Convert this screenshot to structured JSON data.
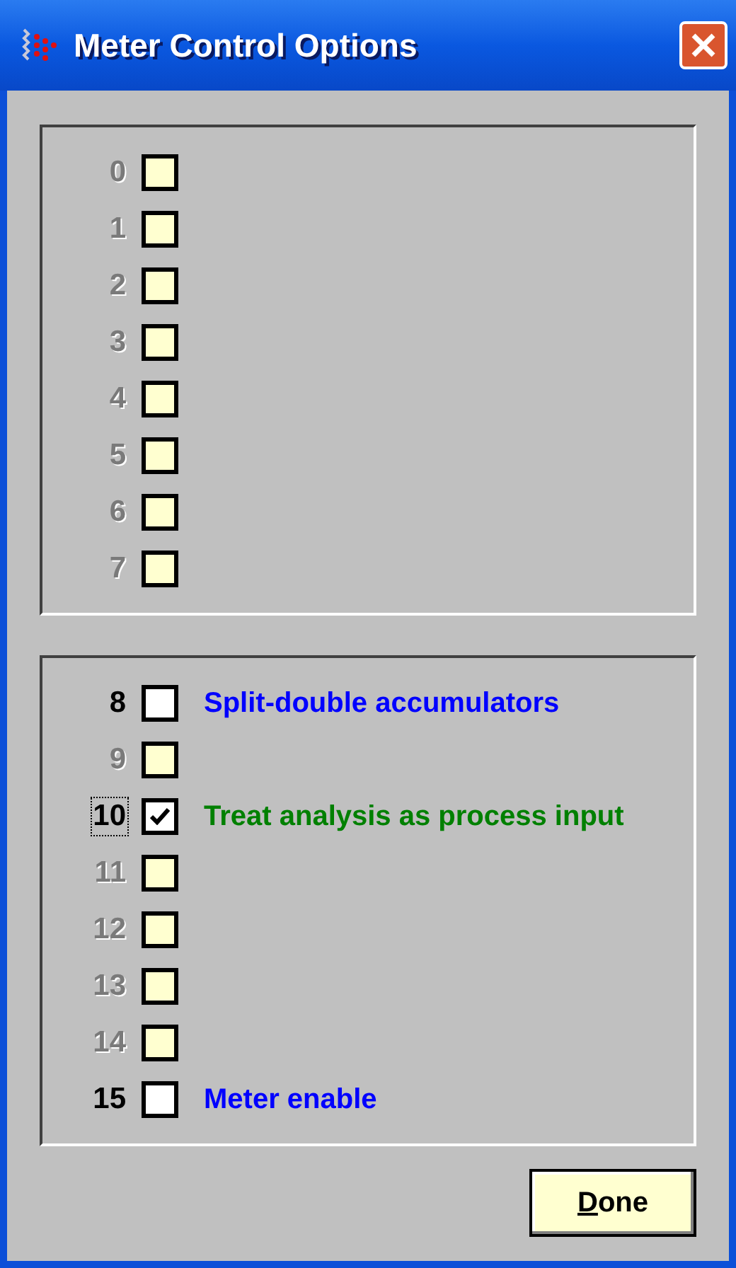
{
  "window": {
    "title": "Meter Control Options"
  },
  "groups": [
    {
      "bits": [
        {
          "number": "0",
          "disabled": true,
          "checked": false,
          "focused": false
        },
        {
          "number": "1",
          "disabled": true,
          "checked": false,
          "focused": false
        },
        {
          "number": "2",
          "disabled": true,
          "checked": false,
          "focused": false
        },
        {
          "number": "3",
          "disabled": true,
          "checked": false,
          "focused": false
        },
        {
          "number": "4",
          "disabled": true,
          "checked": false,
          "focused": false
        },
        {
          "number": "5",
          "disabled": true,
          "checked": false,
          "focused": false
        },
        {
          "number": "6",
          "disabled": true,
          "checked": false,
          "focused": false
        },
        {
          "number": "7",
          "disabled": true,
          "checked": false,
          "focused": false
        }
      ]
    },
    {
      "bits": [
        {
          "number": "8",
          "disabled": false,
          "checked": false,
          "focused": false,
          "label": "Split-double accumulators",
          "color": "#0000ff"
        },
        {
          "number": "9",
          "disabled": true,
          "checked": false,
          "focused": false
        },
        {
          "number": "10",
          "disabled": false,
          "checked": true,
          "focused": true,
          "label": "Treat analysis as process input",
          "color": "#008000"
        },
        {
          "number": "11",
          "disabled": true,
          "checked": false,
          "focused": false
        },
        {
          "number": "12",
          "disabled": true,
          "checked": false,
          "focused": false
        },
        {
          "number": "13",
          "disabled": true,
          "checked": false,
          "focused": false
        },
        {
          "number": "14",
          "disabled": true,
          "checked": false,
          "focused": false
        },
        {
          "number": "15",
          "disabled": false,
          "checked": false,
          "focused": false,
          "label": "Meter enable",
          "color": "#0000ff"
        }
      ]
    }
  ],
  "buttons": [
    {
      "label": "Done",
      "mnemonic": true
    }
  ]
}
